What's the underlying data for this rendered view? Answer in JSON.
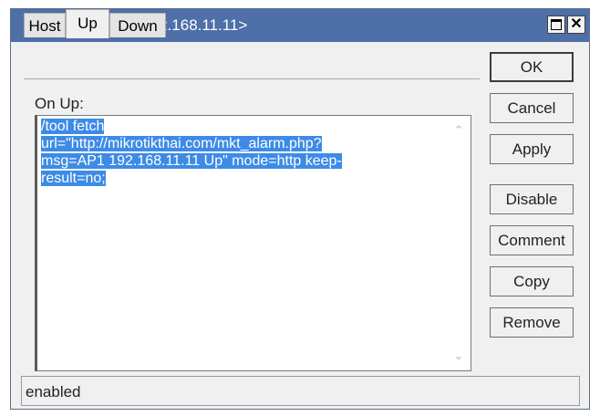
{
  "window": {
    "title": "Netwatch Host <192.168.11.11>"
  },
  "tabs": [
    {
      "label": "Host",
      "active": false
    },
    {
      "label": "Up",
      "active": true
    },
    {
      "label": "Down",
      "active": false
    }
  ],
  "on_up": {
    "label": "On Up:",
    "lines": [
      "/tool fetch",
      "url=\"http://mikrotikthai.com/mkt_alarm.php?",
      "msg=AP1 192.168.11.11 Up\" mode=http keep-",
      "result=no;"
    ]
  },
  "buttons": {
    "ok": "OK",
    "cancel": "Cancel",
    "apply": "Apply",
    "disable": "Disable",
    "comment": "Comment",
    "copy": "Copy",
    "remove": "Remove"
  },
  "status": {
    "text": "enabled"
  },
  "icons": {
    "maximize": "maximize-icon",
    "close": "close-icon",
    "scroll_up": "scroll-up-arrow-icon",
    "scroll_down": "scroll-down-arrow-icon"
  },
  "colors": {
    "titlebar": "#4e6fa8",
    "selection": "#3d8be6"
  }
}
